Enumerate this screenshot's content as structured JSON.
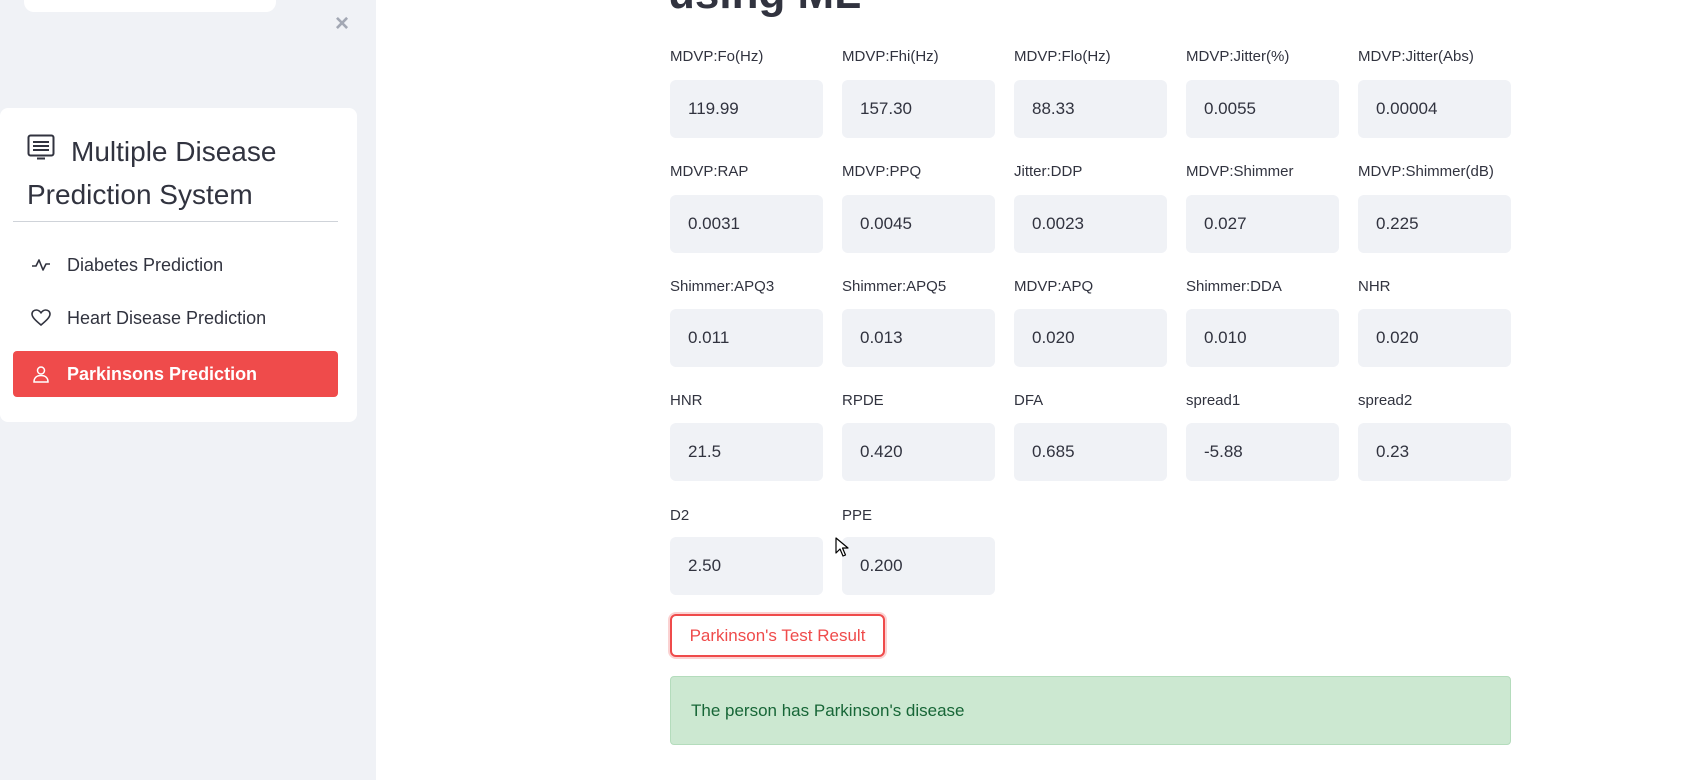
{
  "sidebar": {
    "close_icon": "×",
    "menu_title": "Multiple Disease Prediction System",
    "items": [
      {
        "label": "Diabetes Prediction",
        "icon": "activity-icon",
        "active": false
      },
      {
        "label": "Heart Disease Prediction",
        "icon": "heart-icon",
        "active": false
      },
      {
        "label": "Parkinsons Prediction",
        "icon": "person-icon",
        "active": true
      }
    ]
  },
  "main": {
    "title": "using ML",
    "fields": [
      {
        "label": "MDVP:Fo(Hz)",
        "value": "119.99"
      },
      {
        "label": "MDVP:Fhi(Hz)",
        "value": "157.30"
      },
      {
        "label": "MDVP:Flo(Hz)",
        "value": "88.33"
      },
      {
        "label": "MDVP:Jitter(%)",
        "value": "0.0055"
      },
      {
        "label": "MDVP:Jitter(Abs)",
        "value": "0.00004"
      },
      {
        "label": "MDVP:RAP",
        "value": "0.0031"
      },
      {
        "label": "MDVP:PPQ",
        "value": "0.0045"
      },
      {
        "label": "Jitter:DDP",
        "value": "0.0023"
      },
      {
        "label": "MDVP:Shimmer",
        "value": "0.027"
      },
      {
        "label": "MDVP:Shimmer(dB)",
        "value": "0.225"
      },
      {
        "label": "Shimmer:APQ3",
        "value": "0.011"
      },
      {
        "label": "Shimmer:APQ5",
        "value": "0.013"
      },
      {
        "label": "MDVP:APQ",
        "value": "0.020"
      },
      {
        "label": "Shimmer:DDA",
        "value": "0.010"
      },
      {
        "label": "NHR",
        "value": "0.020"
      },
      {
        "label": "HNR",
        "value": "21.5"
      },
      {
        "label": "RPDE",
        "value": "0.420"
      },
      {
        "label": "DFA",
        "value": "0.685"
      },
      {
        "label": "spread1",
        "value": "-5.88"
      },
      {
        "label": "spread2",
        "value": "0.23"
      },
      {
        "label": "D2",
        "value": "2.50"
      },
      {
        "label": "PPE",
        "value": "0.200"
      }
    ],
    "button_label": "Parkinson's Test Result",
    "result_text": "The person has Parkinson's disease"
  },
  "colors": {
    "accent": "#ef4b4b",
    "sidebar_bg": "#f0f2f6",
    "success_bg": "#cce8d1",
    "success_text": "#176637"
  }
}
